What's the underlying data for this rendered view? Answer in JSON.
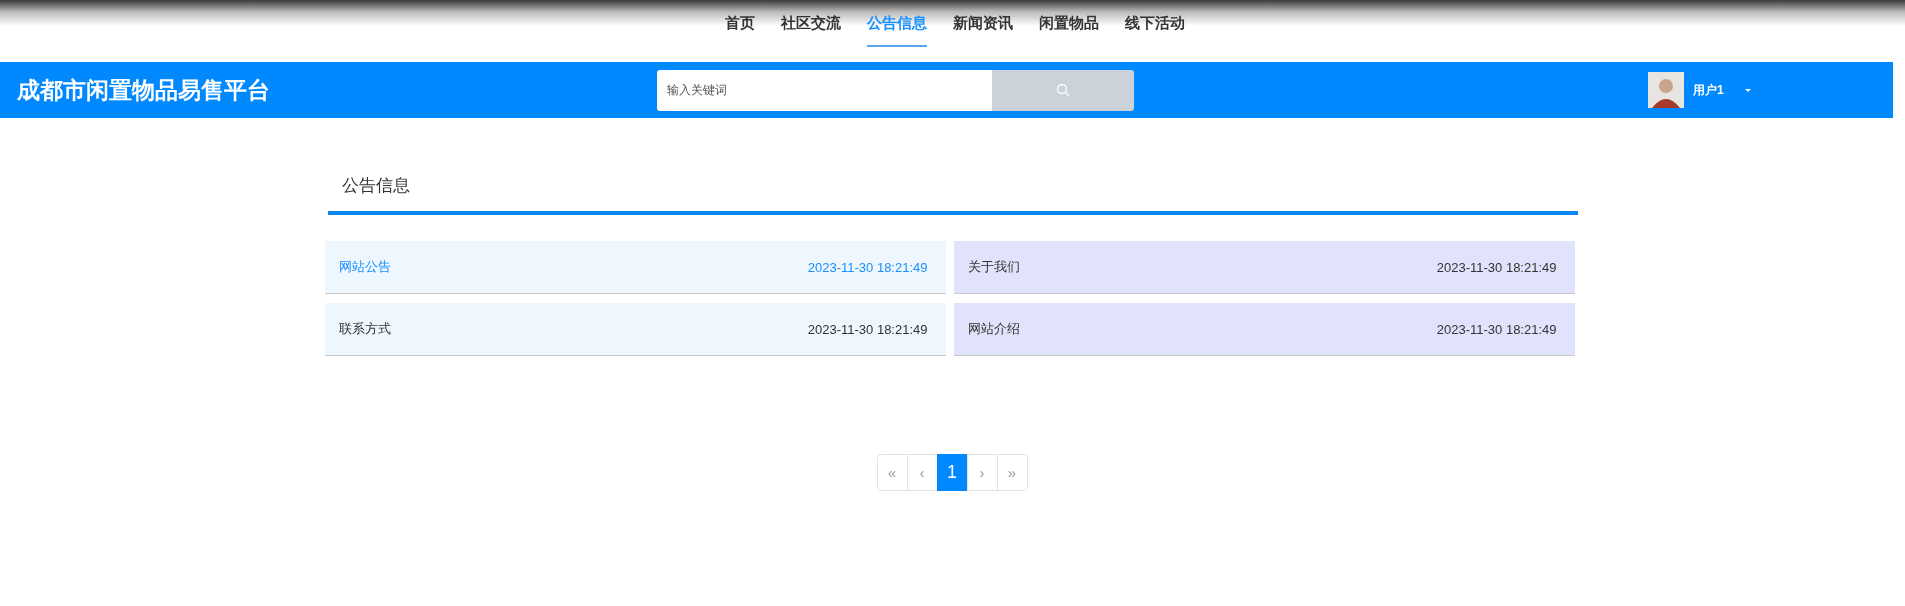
{
  "nav": [
    {
      "label": "首页",
      "selected": false
    },
    {
      "label": "社区交流",
      "selected": false
    },
    {
      "label": "公告信息",
      "selected": true
    },
    {
      "label": "新闻资讯",
      "selected": false
    },
    {
      "label": "闲置物品",
      "selected": false
    },
    {
      "label": "线下活动",
      "selected": false
    }
  ],
  "header": {
    "title": "成都市闲置物品易售平台",
    "search": {
      "placeholder": "输入关键词"
    },
    "user": {
      "name": "用户1"
    }
  },
  "section": {
    "title": "公告信息"
  },
  "notices": [
    {
      "title": "网站公告",
      "time": "2023-11-30 18:21:49",
      "hovered": true,
      "color": "#eef6fe"
    },
    {
      "title": "关于我们",
      "time": "2023-11-30 18:21:49",
      "hovered": false,
      "color": "#e0e3fb"
    },
    {
      "title": "联系方式",
      "time": "2023-11-30 18:21:49",
      "hovered": false,
      "color": "#eef6fe"
    },
    {
      "title": "网站介绍",
      "time": "2023-11-30 18:21:49",
      "hovered": false,
      "color": "#e0e3fb"
    }
  ],
  "pagination": [
    {
      "label": "«",
      "selected": false
    },
    {
      "label": "‹",
      "selected": false
    },
    {
      "label": "1",
      "selected": true
    },
    {
      "label": "›",
      "selected": false
    },
    {
      "label": "»",
      "selected": false
    }
  ]
}
